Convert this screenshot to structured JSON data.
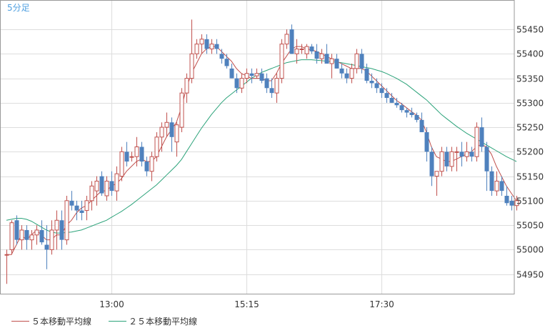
{
  "chart_data": {
    "type": "candlestick",
    "title": "5分足",
    "colors": {
      "up": "#c0504d",
      "down": "#4f81bd",
      "ma5": "#c0504d",
      "ma25": "#2ca37a",
      "grid": "#dddddd",
      "frame": "#999999"
    },
    "y_ticks": [
      54950,
      55000,
      55050,
      55100,
      55150,
      55200,
      55250,
      55300,
      55350,
      55400,
      55450
    ],
    "ylim": [
      54910,
      55510
    ],
    "grid": true,
    "x_ticks": [
      {
        "label": "13:00",
        "index": 21
      },
      {
        "label": "15:15",
        "index": 48
      },
      {
        "label": "17:30",
        "index": 75
      }
    ],
    "candles": [
      [
        54990,
        55000,
        54930,
        54990
      ],
      [
        55000,
        55060,
        54990,
        55055
      ],
      [
        55060,
        55070,
        55010,
        55020
      ],
      [
        55020,
        55050,
        55000,
        55040
      ],
      [
        55040,
        55050,
        55000,
        55020
      ],
      [
        55020,
        55040,
        55000,
        55030
      ],
      [
        55030,
        55050,
        55010,
        55040
      ],
      [
        55040,
        55060,
        55010,
        55015
      ],
      [
        55010,
        55050,
        54960,
        55000
      ],
      [
        55000,
        55060,
        54990,
        55040
      ],
      [
        55040,
        55080,
        55000,
        55060
      ],
      [
        55060,
        55080,
        55000,
        55020
      ],
      [
        55020,
        55110,
        55010,
        55100
      ],
      [
        55100,
        55120,
        55080,
        55090
      ],
      [
        55090,
        55100,
        55060,
        55080
      ],
      [
        55080,
        55100,
        55060,
        55075
      ],
      [
        55080,
        55110,
        55060,
        55100
      ],
      [
        55100,
        55140,
        55080,
        55130
      ],
      [
        55120,
        55150,
        55090,
        55140
      ],
      [
        55150,
        55160,
        55110,
        55115
      ],
      [
        55110,
        55150,
        55100,
        55140
      ],
      [
        55140,
        55160,
        55110,
        55120
      ],
      [
        55120,
        55170,
        55100,
        55155
      ],
      [
        55150,
        55210,
        55140,
        55200
      ],
      [
        55200,
        55220,
        55170,
        55180
      ],
      [
        55190,
        55200,
        55180,
        55190
      ],
      [
        55190,
        55230,
        55170,
        55210
      ],
      [
        55210,
        55220,
        55170,
        55180
      ],
      [
        55180,
        55190,
        55150,
        55160
      ],
      [
        55160,
        55200,
        55140,
        55190
      ],
      [
        55190,
        55240,
        55180,
        55230
      ],
      [
        55230,
        55260,
        55200,
        55250
      ],
      [
        55250,
        55280,
        55230,
        55260
      ],
      [
        55260,
        55270,
        55200,
        55230
      ],
      [
        55220,
        55260,
        55190,
        55255
      ],
      [
        55250,
        55330,
        55240,
        55320
      ],
      [
        55320,
        55360,
        55300,
        55350
      ],
      [
        55350,
        55470,
        55340,
        55400
      ],
      [
        55400,
        55430,
        55390,
        55420
      ],
      [
        55420,
        55440,
        55400,
        55430
      ],
      [
        55430,
        55440,
        55400,
        55410
      ],
      [
        55410,
        55430,
        55400,
        55420
      ],
      [
        55420,
        55430,
        55400,
        55410
      ],
      [
        55400,
        55410,
        55380,
        55390
      ],
      [
        55390,
        55400,
        55370,
        55375
      ],
      [
        55370,
        55380,
        55350,
        55350
      ],
      [
        55350,
        55360,
        55320,
        55330
      ],
      [
        55330,
        55360,
        55320,
        55350
      ],
      [
        55350,
        55370,
        55340,
        55360
      ],
      [
        55360,
        55370,
        55340,
        55355
      ],
      [
        55355,
        55370,
        55350,
        55360
      ],
      [
        55360,
        55370,
        55340,
        55345
      ],
      [
        55350,
        55360,
        55320,
        55330
      ],
      [
        55330,
        55350,
        55310,
        55320
      ],
      [
        55320,
        55360,
        55300,
        55350
      ],
      [
        55350,
        55430,
        55340,
        55420
      ],
      [
        55420,
        55450,
        55410,
        55440
      ],
      [
        55450,
        55460,
        55400,
        55400
      ],
      [
        55400,
        55430,
        55380,
        55410
      ],
      [
        55410,
        55420,
        55400,
        55410
      ],
      [
        55400,
        55420,
        55390,
        55415
      ],
      [
        55415,
        55420,
        55400,
        55405
      ],
      [
        55405,
        55420,
        55380,
        55390
      ],
      [
        55390,
        55410,
        55380,
        55400
      ],
      [
        55400,
        55420,
        55380,
        55380
      ],
      [
        55380,
        55400,
        55350,
        55390
      ],
      [
        55390,
        55400,
        55370,
        55370
      ],
      [
        55370,
        55380,
        55350,
        55360
      ],
      [
        55360,
        55370,
        55340,
        55350
      ],
      [
        55350,
        55380,
        55340,
        55370
      ],
      [
        55370,
        55410,
        55360,
        55400
      ],
      [
        55400,
        55410,
        55360,
        55370
      ],
      [
        55370,
        55380,
        55340,
        55345
      ],
      [
        55345,
        55360,
        55330,
        55340
      ],
      [
        55340,
        55350,
        55320,
        55330
      ],
      [
        55330,
        55340,
        55310,
        55320
      ],
      [
        55320,
        55330,
        55300,
        55310
      ],
      [
        55310,
        55320,
        55300,
        55300
      ],
      [
        55300,
        55310,
        55290,
        55295
      ],
      [
        55295,
        55300,
        55280,
        55285
      ],
      [
        55285,
        55290,
        55270,
        55280
      ],
      [
        55280,
        55290,
        55270,
        55275
      ],
      [
        55275,
        55280,
        55260,
        55265
      ],
      [
        55265,
        55280,
        55240,
        55240
      ],
      [
        55240,
        55250,
        55180,
        55200
      ],
      [
        55200,
        55210,
        55130,
        55150
      ],
      [
        55150,
        55160,
        55110,
        55160
      ],
      [
        55160,
        55210,
        55150,
        55200
      ],
      [
        55200,
        55210,
        55160,
        55170
      ],
      [
        55170,
        55210,
        55160,
        55200
      ],
      [
        55200,
        55210,
        55160,
        55200
      ],
      [
        55200,
        55220,
        55170,
        55190
      ],
      [
        55190,
        55220,
        55180,
        55200
      ],
      [
        55200,
        55210,
        55180,
        55190
      ],
      [
        55190,
        55260,
        55180,
        55250
      ],
      [
        55250,
        55270,
        55200,
        55210
      ],
      [
        55210,
        55220,
        55120,
        55160
      ],
      [
        55160,
        55170,
        55110,
        55120
      ],
      [
        55120,
        55160,
        55110,
        55140
      ],
      [
        55140,
        55150,
        55110,
        55120
      ],
      [
        55110,
        55130,
        55090,
        55095
      ],
      [
        55100,
        55110,
        55080,
        55090
      ],
      [
        55090,
        55110,
        55080,
        55100
      ]
    ],
    "series": [
      {
        "name": "５本移動平均線",
        "values": [
          54990,
          54990,
          55010,
          55030,
          55020,
          55030,
          55040,
          55030,
          55020,
          55020,
          55030,
          55030,
          55050,
          55060,
          55075,
          55085,
          55090,
          55100,
          55110,
          55120,
          55120,
          55130,
          55135,
          55145,
          55160,
          55170,
          55180,
          55185,
          55180,
          55180,
          55190,
          55210,
          55230,
          55245,
          55260,
          55290,
          55330,
          55360,
          55380,
          55400,
          55410,
          55415,
          55415,
          55405,
          55395,
          55385,
          55370,
          55360,
          55355,
          55350,
          55350,
          55350,
          55345,
          55345,
          55360,
          55380,
          55395,
          55410,
          55415,
          55415,
          55410,
          55408,
          55405,
          55400,
          55395,
          55390,
          55385,
          55380,
          55375,
          55370,
          55370,
          55370,
          55365,
          55355,
          55345,
          55335,
          55325,
          55315,
          55305,
          55298,
          55290,
          55282,
          55275,
          55265,
          55240,
          55210,
          55190,
          55185,
          55180,
          55180,
          55185,
          55190,
          55195,
          55200,
          55210,
          55215,
          55210,
          55195,
          55170,
          55150,
          55130,
          55115,
          55100
        ]
      },
      {
        "name": "２５本移動平均線",
        "values": [
          55060,
          55062,
          55064,
          55064,
          55062,
          55058,
          55052,
          55046,
          55040,
          55036,
          55034,
          55034,
          55035,
          55036,
          55038,
          55040,
          55044,
          55048,
          55052,
          55056,
          55060,
          55066,
          55072,
          55078,
          55085,
          55092,
          55100,
          55108,
          55116,
          55124,
          55132,
          55142,
          55152,
          55162,
          55172,
          55184,
          55200,
          55216,
          55232,
          55248,
          55262,
          55276,
          55288,
          55300,
          55310,
          55318,
          55326,
          55334,
          55342,
          55350,
          55356,
          55362,
          55366,
          55370,
          55374,
          55378,
          55382,
          55384,
          55386,
          55388,
          55388,
          55388,
          55387,
          55386,
          55385,
          55384,
          55383,
          55382,
          55380,
          55378,
          55376,
          55374,
          55372,
          55370,
          55367,
          55364,
          55360,
          55355,
          55350,
          55344,
          55338,
          55330,
          55322,
          55314,
          55306,
          55296,
          55286,
          55276,
          55268,
          55260,
          55252,
          55245,
          55238,
          55232,
          55226,
          55220,
          55214,
          55208,
          55202,
          55196,
          55190,
          55185,
          55180
        ]
      }
    ]
  }
}
